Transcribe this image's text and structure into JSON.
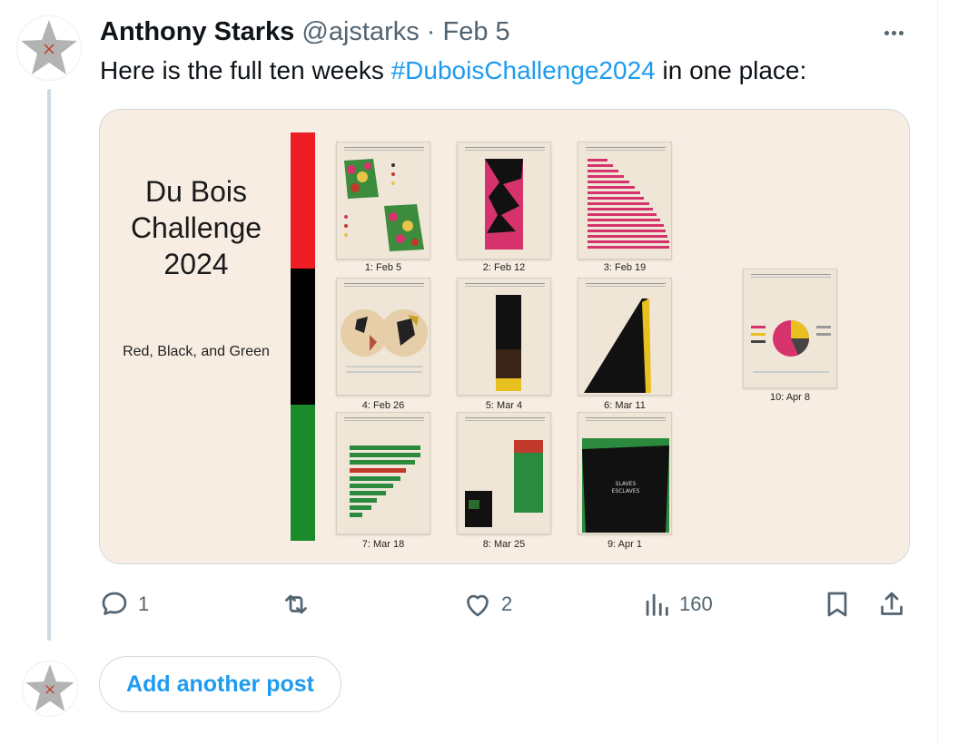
{
  "post": {
    "author_name": "Anthony Starks",
    "author_handle": "@ajstarks",
    "separator": " · ",
    "date": "Feb 5",
    "text_before": "Here is the full ten weeks ",
    "hashtag": "#DuboisChallenge2024",
    "text_after": " in one place:"
  },
  "media": {
    "title_lines": [
      "Du Bois",
      "Challenge",
      "2024"
    ],
    "subtitle": "Red, Black, and Green",
    "flag_colors": [
      "#ee1c25",
      "#000000",
      "#1a8a2a"
    ],
    "captions": [
      "1: Feb 5",
      "2: Feb 12",
      "3: Feb 19",
      "4: Feb 26",
      "5: Mar 4",
      "6: Mar 11",
      "7: Mar 18",
      "8: Mar 25",
      "9: Apr 1",
      "10: Apr 8"
    ]
  },
  "actions": {
    "replies": "1",
    "reposts": "",
    "likes": "2",
    "views": "160"
  },
  "add_post_label": "Add another post",
  "colors": {
    "accent": "#1d9bf0",
    "muted": "#536471",
    "border": "#cfd9de"
  }
}
